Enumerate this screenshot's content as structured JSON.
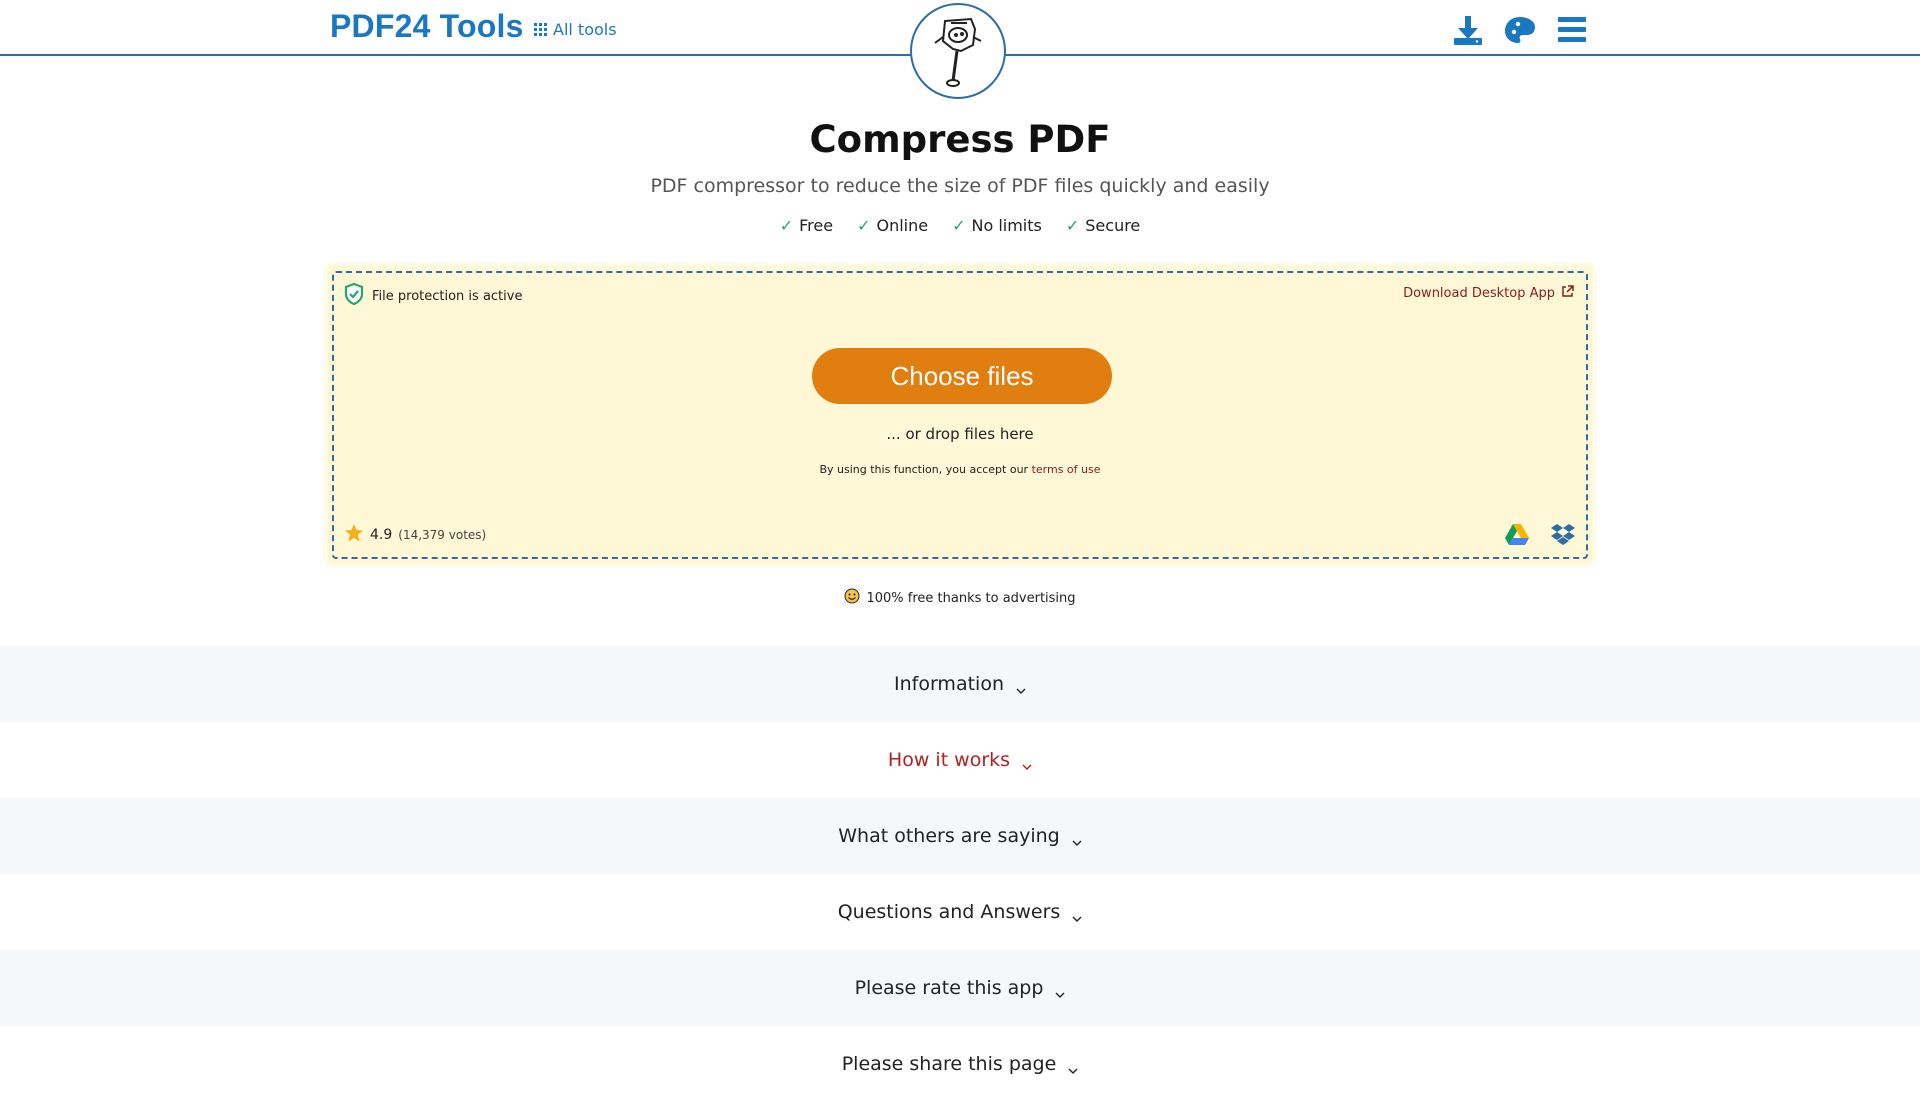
{
  "header": {
    "brand": "PDF24 Tools",
    "all_tools_label": "All tools",
    "icons": [
      "download-icon",
      "palette-icon",
      "hamburger-menu-icon"
    ]
  },
  "hero": {
    "title": "Compress PDF",
    "subtitle": "PDF compressor to reduce the size of PDF files quickly and easily",
    "features": [
      "Free",
      "Online",
      "No limits",
      "Secure"
    ]
  },
  "upload": {
    "protection_label": "File protection is active",
    "desktop_app_link": "Download Desktop App",
    "choose_button": "Choose files",
    "drop_text": "... or drop files here",
    "terms_prefix": "By using this function, you accept our ",
    "terms_link": "terms of use",
    "rating_value": "4.9",
    "rating_votes": "(14,379 votes)",
    "cloud_icons": [
      "google-drive-icon",
      "dropbox-icon"
    ]
  },
  "free_note": "100% free thanks to advertising",
  "sections": [
    {
      "label": "Information"
    },
    {
      "label": "How it works"
    },
    {
      "label": "What others are saying"
    },
    {
      "label": "Questions and Answers"
    },
    {
      "label": "Please rate this app"
    },
    {
      "label": "Please share this page"
    }
  ],
  "colors": {
    "brand_blue": "#1a78c2",
    "accent_orange": "#e07f0f",
    "drop_bg": "#fff8d6",
    "link_red": "#8b1c1c",
    "check_green": "#2aa56f"
  }
}
